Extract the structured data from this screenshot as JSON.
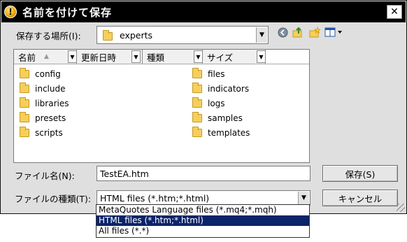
{
  "dialog": {
    "title": "名前を付けて保存",
    "close_glyph": "✕"
  },
  "save_in": {
    "label": "保存する場所(I):",
    "value": "experts"
  },
  "toolbar": {
    "icons": [
      "back-icon",
      "up-folder-icon",
      "new-folder-icon",
      "view-menu-icon"
    ]
  },
  "columns": [
    "名前",
    "更新日時",
    "種類",
    "サイズ"
  ],
  "files": [
    {
      "name": "config"
    },
    {
      "name": "include"
    },
    {
      "name": "libraries"
    },
    {
      "name": "presets"
    },
    {
      "name": "scripts"
    },
    {
      "name": "files"
    },
    {
      "name": "indicators"
    },
    {
      "name": "logs"
    },
    {
      "name": "samples"
    },
    {
      "name": "templates"
    }
  ],
  "filename": {
    "label": "ファイル名(N):",
    "value": "TestEA.htm"
  },
  "filetype": {
    "label": "ファイルの種類(T):",
    "value": "HTML files (*.htm;*.html)",
    "options": [
      "MetaQuotes Language files (*.mq4;*.mqh)",
      "HTML files (*.htm;*.html)",
      "All files (*.*)"
    ]
  },
  "buttons": {
    "save": "保存(S)",
    "cancel": "キャンセル"
  }
}
